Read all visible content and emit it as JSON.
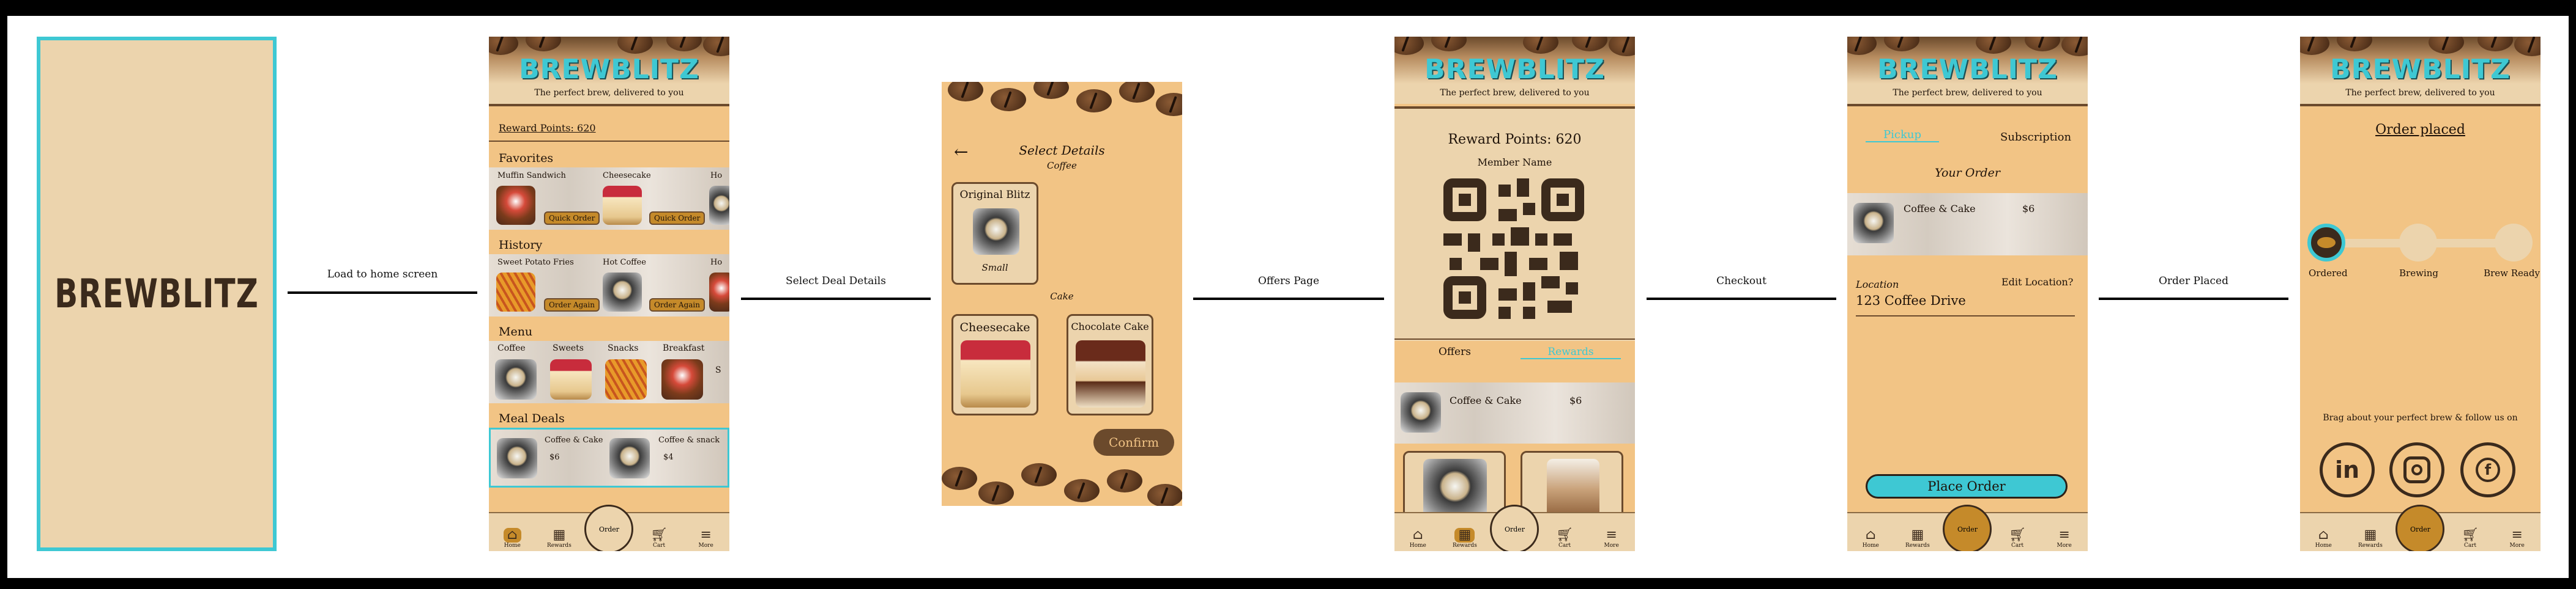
{
  "splash": {
    "logo": "BREWBLITZ"
  },
  "arrows": [
    {
      "label": "Load to home screen"
    },
    {
      "label": "Select Deal Details"
    },
    {
      "label": "Offers Page"
    },
    {
      "label": "Checkout"
    },
    {
      "label": "Order Placed"
    }
  ],
  "header": {
    "brand": "BREWBLITZ",
    "tagline": "The perfect brew, delivered to you"
  },
  "nav": {
    "home": "Home",
    "rewards": "Rewards",
    "order": "Order",
    "cart": "Cart",
    "more": "More"
  },
  "home": {
    "reward_points": "Reward Points: 620",
    "favorites_title": "Favorites",
    "favorites": [
      {
        "name": "Muffin Sandwich",
        "button": "Quick Order"
      },
      {
        "name": "Cheesecake",
        "button": "Quick Order"
      },
      {
        "name": "Ho"
      }
    ],
    "history_title": "History",
    "history": [
      {
        "name": "Sweet Potato Fries",
        "button": "Order Again"
      },
      {
        "name": "Hot Coffee",
        "button": "Order Again"
      },
      {
        "name": "Ho"
      }
    ],
    "menu_title": "Menu",
    "menu": [
      {
        "name": "Coffee"
      },
      {
        "name": "Sweets"
      },
      {
        "name": "Snacks"
      },
      {
        "name": "Breakfast"
      },
      {
        "name": "S"
      }
    ],
    "deals_title": "Meal Deals",
    "deals": [
      {
        "name": "Coffee & Cake",
        "price": "$6"
      },
      {
        "name": "Coffee & snack",
        "price": "$4"
      }
    ]
  },
  "details": {
    "title": "Select Details",
    "coffee_label": "Coffee",
    "coffee_option": {
      "name": "Original Blitz",
      "size": "Small"
    },
    "cake_label": "Cake",
    "cake_options": [
      {
        "name": "Cheesecake"
      },
      {
        "name": "Chocolate Cake"
      }
    ],
    "confirm": "Confirm"
  },
  "offers": {
    "reward_points": "Reward Points: 620",
    "member_label": "Member Name",
    "tab_offers": "Offers",
    "tab_rewards": "Rewards",
    "item": {
      "name": "Coffee & Cake",
      "price": "$6"
    }
  },
  "checkout": {
    "tab_pickup": "Pickup",
    "tab_subscription": "Subscription",
    "your_order": "Your Order",
    "item": {
      "name": "Coffee & Cake",
      "price": "$6"
    },
    "location_label": "Location",
    "edit_location": "Edit Location?",
    "address": "123 Coffee Drive",
    "place_order": "Place Order"
  },
  "placed": {
    "title": "Order placed",
    "steps": [
      {
        "label": "Ordered"
      },
      {
        "label": "Brewing"
      },
      {
        "label": "Brew Ready"
      }
    ],
    "progress": 0,
    "brag": "Brag about your perfect brew & follow us on",
    "social": [
      {
        "name": "in"
      },
      {
        "name": "instagram"
      },
      {
        "name": "f"
      }
    ]
  },
  "colors": {
    "accent": "#3ec8d3",
    "background": "#f2c485",
    "panel": "#ecd4ad",
    "button": "#c58a2a",
    "dark": "#3b2a1c"
  }
}
